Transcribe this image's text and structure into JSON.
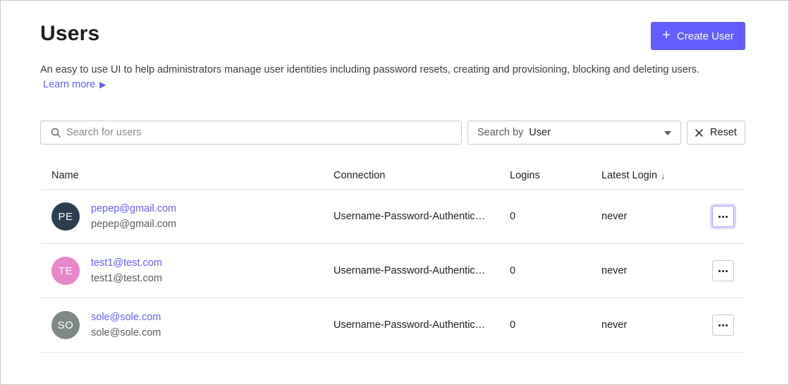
{
  "header": {
    "title": "Users",
    "create_button_label": "Create User",
    "description": "An easy to use UI to help administrators manage user identities including password resets, creating and provisioning, blocking and deleting users.",
    "learn_more": "Learn more",
    "learn_more_arrow": "▶"
  },
  "filters": {
    "search_placeholder": "Search for users",
    "search_by_label": "Search by",
    "search_by_value": "User",
    "reset_label": "Reset"
  },
  "table": {
    "columns": {
      "name": "Name",
      "connection": "Connection",
      "logins": "Logins",
      "latest_login": "Latest Login",
      "sort_icon": "↓"
    },
    "rows": [
      {
        "initials": "PE",
        "avatar_color": "#2c3e50",
        "name": "pepep@gmail.com",
        "email": "pepep@gmail.com",
        "connection": "Username-Password-Authentication",
        "logins": "0",
        "latest_login": "never"
      },
      {
        "initials": "TE",
        "avatar_color": "#e786c8",
        "name": "test1@test.com",
        "email": "test1@test.com",
        "connection": "Username-Password-Authentication",
        "logins": "0",
        "latest_login": "never"
      },
      {
        "initials": "SO",
        "avatar_color": "#7f8a86",
        "name": "sole@sole.com",
        "email": "sole@sole.com",
        "connection": "Username-Password-Authentication",
        "logins": "0",
        "latest_login": "never"
      }
    ]
  },
  "colors": {
    "accent": "#635dff"
  }
}
